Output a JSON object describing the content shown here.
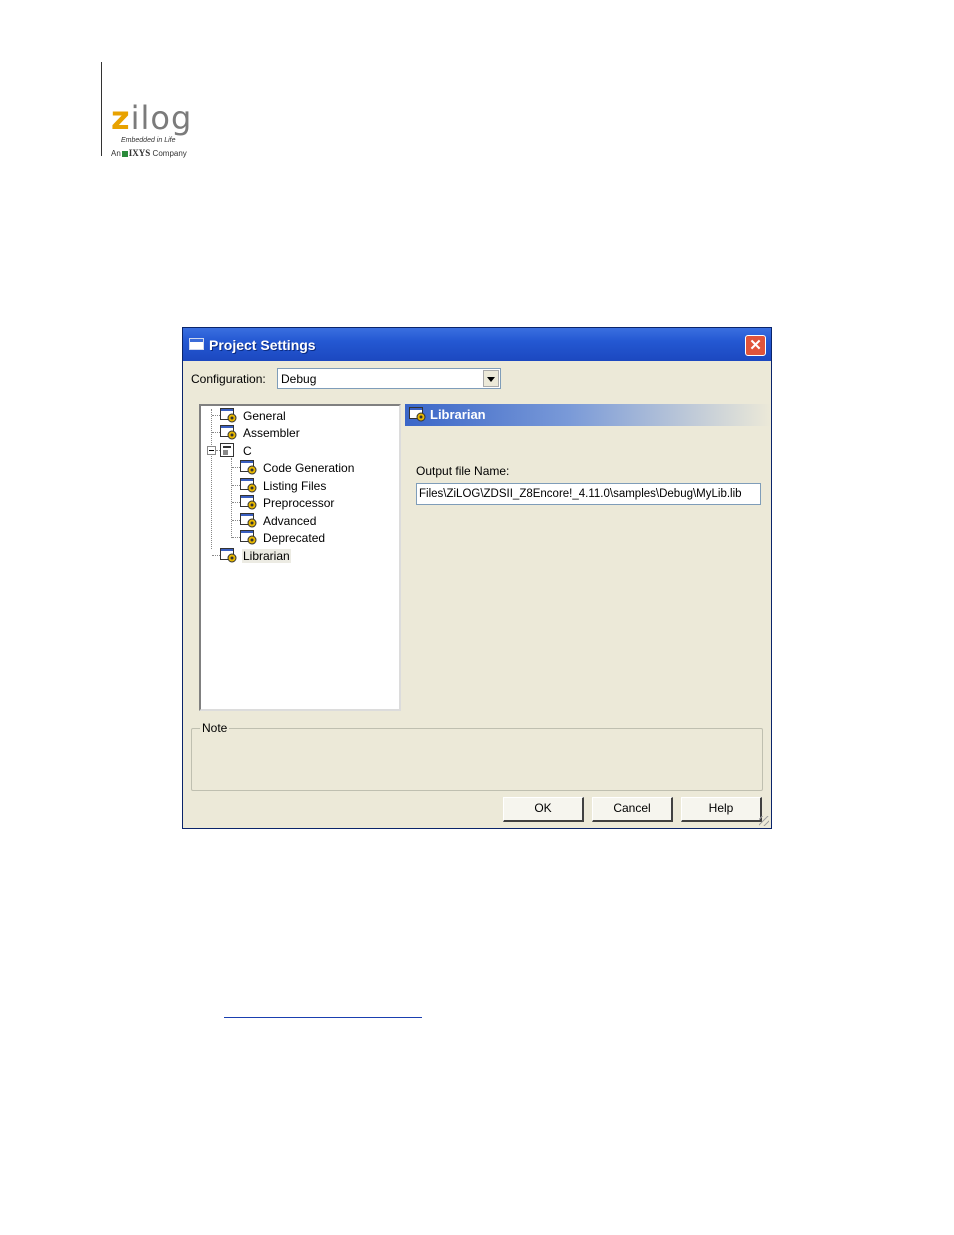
{
  "logo": {
    "word_z": "z",
    "word_rest": "ilog",
    "tagline": "Embedded in Life",
    "company_prefix": "An",
    "company_name": "IXYS",
    "company_suffix": "Company"
  },
  "dialog": {
    "title": "Project Settings",
    "close_glyph": "✕",
    "configuration_label": "Configuration:",
    "configuration_value": "Debug",
    "tree": {
      "items": [
        {
          "label": "General",
          "icon": "settings-page-icon"
        },
        {
          "label": "Assembler",
          "icon": "settings-page-icon"
        },
        {
          "label": "C",
          "icon": "folder-icon"
        },
        {
          "label": "Code Generation",
          "icon": "settings-page-icon"
        },
        {
          "label": "Listing Files",
          "icon": "settings-page-icon"
        },
        {
          "label": "Preprocessor",
          "icon": "settings-page-icon"
        },
        {
          "label": "Advanced",
          "icon": "settings-page-icon"
        },
        {
          "label": "Deprecated",
          "icon": "settings-page-icon"
        },
        {
          "label": "Librarian",
          "icon": "settings-page-icon",
          "selected": true
        }
      ]
    },
    "panel": {
      "title": "Librarian",
      "output_label": "Output file Name:",
      "output_value": "Files\\ZiLOG\\ZDSII_Z8Encore!_4.11.0\\samples\\Debug\\MyLib.lib"
    },
    "note_label": "Note",
    "buttons": {
      "ok": "OK",
      "cancel": "Cancel",
      "help": "Help"
    }
  },
  "colors": {
    "titlebar": "#2458d2",
    "dialog_bg": "#ece9d8",
    "logo_accent": "#e8a200"
  }
}
